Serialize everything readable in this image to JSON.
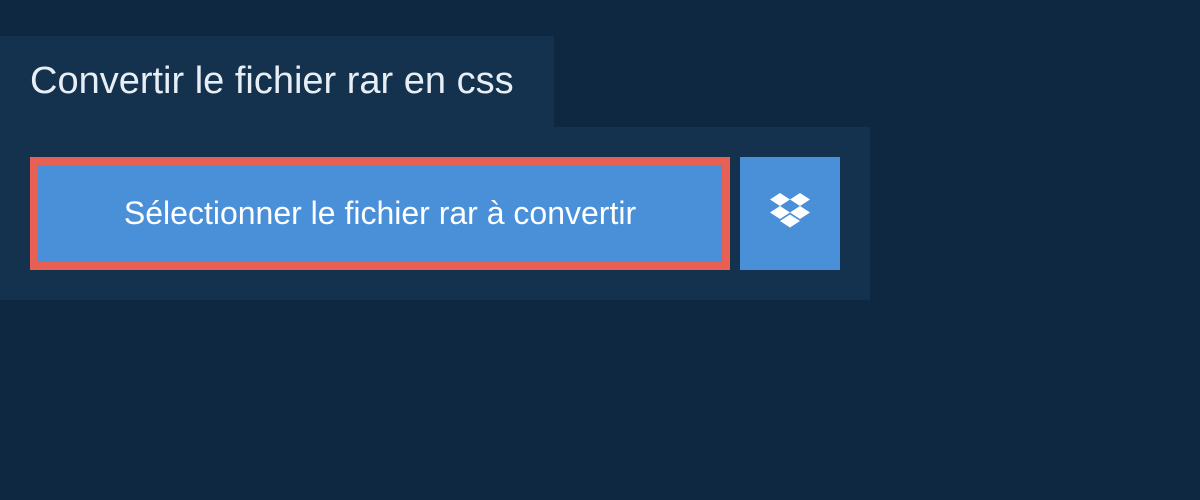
{
  "header": {
    "title": "Convertir le fichier rar en css"
  },
  "actions": {
    "select_file_label": "Sélectionner le fichier rar à convertir",
    "dropbox_icon_name": "dropbox"
  },
  "colors": {
    "background": "#0f2842",
    "panel": "#14324d",
    "button": "#4a90d9",
    "highlight_border": "#e85f54",
    "text": "#ffffff"
  }
}
